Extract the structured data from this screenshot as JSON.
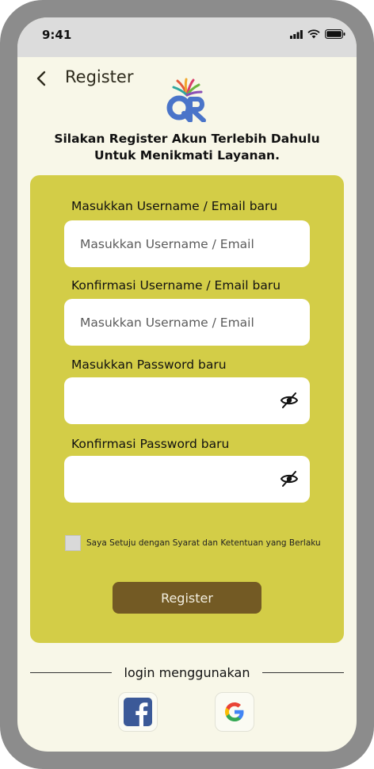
{
  "status_bar": {
    "time": "9:41"
  },
  "header": {
    "title": "Register"
  },
  "subtitle": {
    "line1": "Silakan Register Akun Terlebih Dahulu",
    "line2": "Untuk Menikmati Layanan."
  },
  "form": {
    "username_label": "Masukkan Username / Email baru",
    "username_placeholder": "Masukkan Username / Email",
    "confirm_username_label": "Konfirmasi Username / Email baru",
    "confirm_username_placeholder": "Masukkan Username / Email",
    "password_label": "Masukkan Password baru",
    "confirm_password_label": "Konfirmasi Password baru",
    "agree_text": "Saya Setuju dengan Syarat dan Ketentuan yang Berlaku",
    "register_button": "Register"
  },
  "social": {
    "label": "login menggunakan"
  },
  "colors": {
    "background": "#f8f7e8",
    "card": "#d3cd47",
    "button": "#735a24",
    "logo_blue": "#4a74c9"
  }
}
